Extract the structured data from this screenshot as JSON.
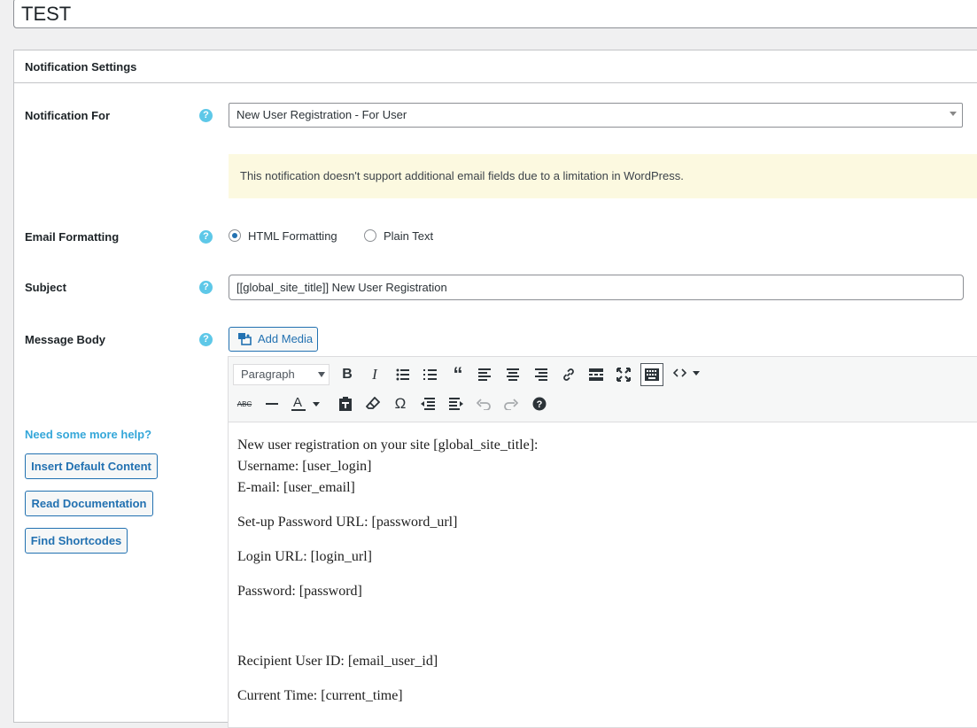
{
  "post_title": "TEST",
  "panel": {
    "title": "Notification Settings"
  },
  "rows": {
    "notification_for": {
      "label": "Notification For",
      "selected": "New User Registration - For User"
    },
    "notice": "This notification doesn't support additional email fields due to a limitation in WordPress.",
    "email_formatting": {
      "label": "Email Formatting",
      "options": [
        "HTML Formatting",
        "Plain Text"
      ],
      "selected": "HTML Formatting"
    },
    "subject": {
      "label": "Subject",
      "value": "[[global_site_title]] New User Registration"
    },
    "message_body": {
      "label": "Message Body"
    }
  },
  "help_icon_glyph": "?",
  "help": {
    "heading": "Need some more help?",
    "buttons": [
      "Insert Default Content",
      "Read Documentation",
      "Find Shortcodes"
    ]
  },
  "editor": {
    "add_media_label": "Add Media",
    "format_select": "Paragraph",
    "toolbar_row1": [
      "bold-icon",
      "italic-icon",
      "bullet-list-icon",
      "numbered-list-icon",
      "blockquote-icon",
      "align-left-icon",
      "align-center-icon",
      "align-right-icon",
      "link-icon",
      "read-more-icon",
      "fullscreen-icon",
      "toolbar-toggle-icon",
      "code-icon"
    ],
    "toolbar_row2": [
      "strikethrough-icon",
      "horizontal-line-icon",
      "text-color-icon",
      "paste-text-icon",
      "clear-formatting-icon",
      "special-character-icon",
      "outdent-icon",
      "indent-icon",
      "undo-icon",
      "redo-icon",
      "help-icon"
    ],
    "content_lines": [
      "New user registration on your site [global_site_title]:",
      "Username: [user_login]",
      "E-mail: [user_email]",
      "Set-up Password URL: [password_url]",
      "Login URL: [login_url]",
      "Password: [password]",
      "Recipient User ID: [email_user_id]",
      "Current Time: [current_time]"
    ]
  },
  "colors": {
    "accent": "#2271b1",
    "help_icon": "#5ec8e8",
    "notice_bg": "#fcf9e0"
  }
}
